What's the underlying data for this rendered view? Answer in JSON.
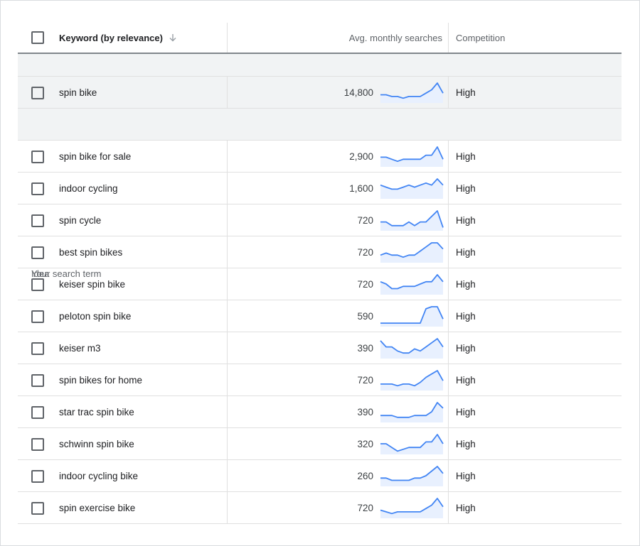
{
  "header": {
    "keyword_label": "Keyword (by relevance)",
    "avg_label": "Avg. monthly searches",
    "competition_label": "Competition",
    "sort_icon": "arrow-down-icon"
  },
  "search_term_group": {
    "label": "Your search term"
  },
  "search_term": {
    "keyword": "spin bike",
    "searches": "14,800",
    "trend": [
      4,
      4,
      3,
      3,
      2,
      3,
      3,
      3,
      5,
      7,
      11,
      5
    ],
    "competition": "High"
  },
  "idea_group": {
    "label": "Idea"
  },
  "ideas": [
    {
      "keyword": "spin bike for sale",
      "searches": "2,900",
      "trend": [
        4,
        4,
        3,
        2,
        3,
        3,
        3,
        3,
        5,
        5,
        9,
        3
      ],
      "competition": "High"
    },
    {
      "keyword": "indoor cycling",
      "searches": "1,600",
      "trend": [
        6,
        5,
        4,
        4,
        5,
        6,
        5,
        6,
        7,
        6,
        9,
        6
      ],
      "competition": "High"
    },
    {
      "keyword": "spin cycle",
      "searches": "720",
      "trend": [
        4,
        4,
        2,
        2,
        2,
        4,
        2,
        4,
        4,
        7,
        10,
        1
      ],
      "competition": "High"
    },
    {
      "keyword": "best spin bikes",
      "searches": "720",
      "trend": [
        3,
        4,
        3,
        3,
        2,
        3,
        3,
        5,
        7,
        9,
        9,
        6
      ],
      "competition": "High"
    },
    {
      "keyword": "keiser spin bike",
      "searches": "720",
      "trend": [
        5,
        4,
        2,
        2,
        3,
        3,
        3,
        4,
        5,
        5,
        8,
        5
      ],
      "competition": "High"
    },
    {
      "keyword": "peloton spin bike",
      "searches": "590",
      "trend": [
        1,
        1,
        1,
        1,
        1,
        1,
        1,
        1,
        8,
        9,
        9,
        3
      ],
      "competition": "High"
    },
    {
      "keyword": "keiser m3",
      "searches": "390",
      "trend": [
        8,
        5,
        5,
        3,
        2,
        2,
        4,
        3,
        5,
        7,
        9,
        5
      ],
      "competition": "High"
    },
    {
      "keyword": "spin bikes for home",
      "searches": "720",
      "trend": [
        3,
        3,
        3,
        2,
        3,
        3,
        2,
        4,
        7,
        9,
        11,
        5
      ],
      "competition": "High"
    },
    {
      "keyword": "star trac spin bike",
      "searches": "390",
      "trend": [
        3,
        3,
        3,
        2,
        2,
        2,
        3,
        3,
        3,
        5,
        10,
        7
      ],
      "competition": "High"
    },
    {
      "keyword": "schwinn spin bike",
      "searches": "320",
      "trend": [
        5,
        5,
        3,
        1,
        2,
        3,
        3,
        3,
        6,
        6,
        10,
        5
      ],
      "competition": "High"
    },
    {
      "keyword": "indoor cycling bike",
      "searches": "260",
      "trend": [
        3,
        3,
        2,
        2,
        2,
        2,
        3,
        3,
        4,
        6,
        8,
        5
      ],
      "competition": "High"
    },
    {
      "keyword": "spin exercise bike",
      "searches": "720",
      "trend": [
        4,
        3,
        2,
        3,
        3,
        3,
        3,
        3,
        5,
        7,
        11,
        6
      ],
      "competition": "High"
    }
  ],
  "colors": {
    "sparkline_line": "#4285f4",
    "sparkline_fill": "#e8f0fe"
  }
}
